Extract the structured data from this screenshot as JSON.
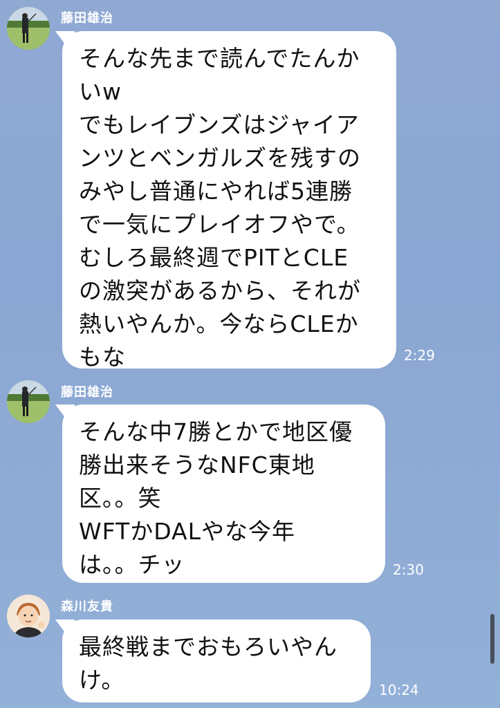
{
  "messages": [
    {
      "sender": "藤田雄治",
      "avatar_icon": "golfer-avatar-icon",
      "lines": [
        "そんな先まで読んでたんか",
        "いw",
        "でもレイブンズはジャイア",
        "ンツとベンガルズを残すの",
        "みやし普通にやれば5連勝",
        "で一気にプレイオフやで。",
        "むしろ最終週でPITとCLE",
        "の激突があるから、それが",
        "熱いやんか。今ならCLEか",
        "もな"
      ],
      "time": "2:29"
    },
    {
      "sender": "藤田雄治",
      "avatar_icon": "golfer-avatar-icon",
      "lines": [
        "そんな中7勝とかで地区優",
        "勝出来そうなNFC東地",
        "区。。笑",
        "WFTかDALやな今年",
        "は。。チッ"
      ],
      "time": "2:30"
    },
    {
      "sender": "森川友貴",
      "avatar_icon": "cartoon-person-avatar-icon",
      "lines": [
        "最終戦までおもろいやん",
        "け。"
      ],
      "time": "10:24"
    }
  ],
  "colors": {
    "background": "#8fa9d3",
    "bubble": "#ffffff",
    "text": "#111111",
    "meta_text": "#ffffff"
  }
}
